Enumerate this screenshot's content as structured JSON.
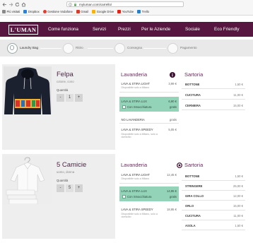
{
  "colors": {
    "brand": "#57163f",
    "accent": "#6b2a5e",
    "selected": "#93d4b9",
    "panel": "#eeeeee",
    "steps": "#e9e9e9",
    "badge": "#3b0e2f"
  },
  "browser": {
    "url": "myluman.com/carrello/",
    "bookmarks": [
      {
        "label": "Più visitati",
        "icon": "gear-icon",
        "color": "#8a8a8a"
      },
      {
        "label": "Dropbox",
        "icon": "dropbox-icon",
        "color": "#2f7fd8"
      },
      {
        "label": "Gestione Vodafone",
        "icon": "vodafone-icon",
        "color": "#e53b2c"
      },
      {
        "label": "Gmail",
        "icon": "gmail-icon",
        "color": "#d93a2b"
      },
      {
        "label": "Google Drive",
        "icon": "google-drive-icon",
        "color": "#f4b400"
      },
      {
        "label": "YouTube",
        "icon": "youtube-icon",
        "color": "#e62117"
      },
      {
        "label": "Trello",
        "icon": "trello-icon",
        "color": "#2d7dc3"
      }
    ]
  },
  "header": {
    "logo": "L'UMAN",
    "nav": [
      "Come funziona",
      "Servizi",
      "Prezzi",
      "Per le Aziende",
      "Sociale",
      "Eco Friendly"
    ]
  },
  "steps": [
    {
      "label": "Laundry Bag",
      "active": true
    },
    {
      "label": "Ritiro",
      "active": false
    },
    {
      "label": "Consegna",
      "active": false
    },
    {
      "label": "Pagamento",
      "active": false
    }
  ],
  "ui": {
    "minus": "-",
    "plus": "+"
  },
  "products": [
    {
      "title": "Felpa",
      "subtitle": "cotone, cono",
      "quantity_label": "Quantità",
      "quantity": "1",
      "laundry": {
        "title": "Lavanderia",
        "options": [
          {
            "name": "LAVA & STIRA LIGHT",
            "price": "3,99 €",
            "note": "Disponibile solo a Milano"
          },
          {
            "name": "LAVA & STIRA LUX",
            "price": "6,90 €",
            "selected": true,
            "extra_label": "Con Smacchiatura",
            "extra_price": "gratis"
          },
          {
            "name": "NO LAVANDERIA",
            "price": "gratis"
          },
          {
            "name": "LAVA & STIRA SPEEDY",
            "price": "5,05 €",
            "note": "Disponibile solo a Milano, solo a domicilio"
          }
        ]
      },
      "tailoring": {
        "title": "Sartoria",
        "items": [
          {
            "name": "BOTTONE",
            "price": "1,50 €"
          },
          {
            "name": "CUCITURA",
            "price": "11,00 €"
          },
          {
            "name": "CERNIERA",
            "price": "15,00 €"
          }
        ]
      }
    },
    {
      "title": "5 Camicie",
      "subtitle": "uomo, donna",
      "quantity_label": "Quantità",
      "quantity": "5",
      "laundry": {
        "title": "Lavanderia",
        "options": [
          {
            "name": "LAVA & STIRA LIGHT",
            "price": "12,45 €",
            "note": "Disponibile solo a Milano"
          },
          {
            "name": "LAVA & STIRA LUX",
            "price": "14,95 €",
            "selected": true,
            "extra_label": "Con Smacchiatura",
            "extra_price": "gratis"
          },
          {
            "name": "LAVA & STIRA SPEEDY",
            "price": "18,95 €",
            "note": "Disponibile solo a Milano, solo a domicilio"
          }
        ]
      },
      "tailoring": {
        "title": "Sartoria",
        "items": [
          {
            "name": "BOTTONE",
            "price": "1,50 €"
          },
          {
            "name": "STRINGERE",
            "price": "25,00 €"
          },
          {
            "name": "GIRA COLLO",
            "price": "12,00 €"
          },
          {
            "name": "ORLO",
            "price": "15,00 €"
          },
          {
            "name": "CUCITURA",
            "price": "11,00 €"
          },
          {
            "name": "ASOLA",
            "price": "1,50 €"
          }
        ]
      }
    }
  ]
}
